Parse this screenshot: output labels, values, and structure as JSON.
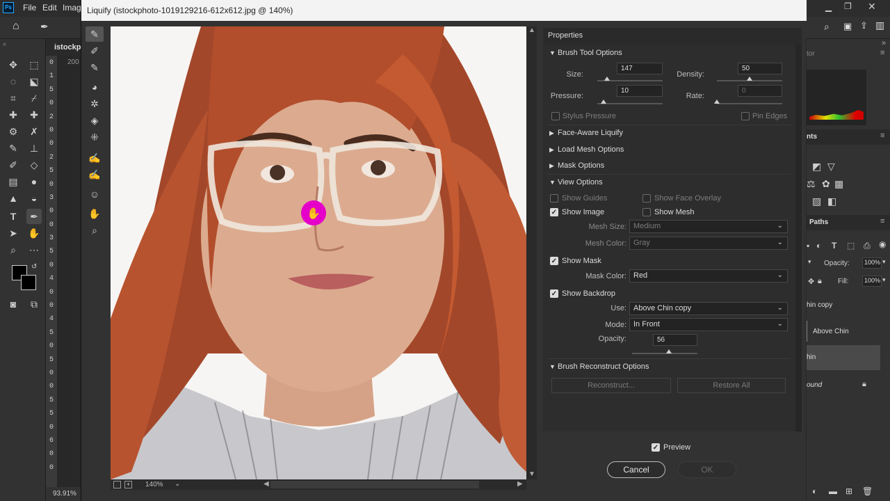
{
  "ps": {
    "logo": "Ps",
    "menus": [
      "File",
      "Edit",
      "Imag"
    ],
    "doc_tab": "istockpl",
    "ruler_top": "200",
    "ruler_digits": [
      "0",
      "1",
      "5",
      "0",
      "2",
      "0",
      "0",
      "2",
      "5",
      "0",
      "3",
      "0",
      "0",
      "3",
      "5",
      "0",
      "4",
      "0",
      "0",
      "4",
      "5",
      "0",
      "5",
      "0",
      "0",
      "5",
      "5",
      "0",
      "6",
      "0",
      "0"
    ],
    "zoom_status": "93.91%",
    "right_panels": {
      "tab1": "tor",
      "tab2": "nts",
      "paths": "Paths",
      "opacity_label": "Opacity:",
      "opacity_value": "100%",
      "fill_label": "Fill:",
      "fill_value": "100%",
      "layer1": "hin copy",
      "layer2": "Above Chin",
      "layer3": "hin",
      "layer4": "ound"
    }
  },
  "dialog": {
    "title": "Liquify (istockphoto-1019129216-612x612.jpg @ 140%)",
    "zoom": "140%",
    "properties": {
      "header": "Properties",
      "brush_tool_options": {
        "title": "Brush Tool Options",
        "size_label": "Size:",
        "size_value": "147",
        "size_level": 0.15,
        "density_label": "Density:",
        "density_value": "50",
        "density_level": 0.5,
        "pressure_label": "Pressure:",
        "pressure_value": "10",
        "pressure_level": 0.1,
        "rate_label": "Rate:",
        "rate_value": "0",
        "rate_level": 0,
        "stylus_pressure": "Stylus Pressure",
        "pin_edges": "Pin Edges"
      },
      "face_aware": "Face-Aware Liquify",
      "load_mesh": "Load Mesh Options",
      "mask_options": "Mask Options",
      "view_options": {
        "title": "View Options",
        "show_guides": "Show Guides",
        "show_face_overlay": "Show Face Overlay",
        "show_image": "Show Image",
        "show_mesh": "Show Mesh",
        "mesh_size_label": "Mesh Size:",
        "mesh_size_value": "Medium",
        "mesh_color_label": "Mesh Color:",
        "mesh_color_value": "Gray",
        "show_mask": "Show Mask",
        "mask_color_label": "Mask Color:",
        "mask_color_value": "Red",
        "show_backdrop": "Show Backdrop",
        "use_label": "Use:",
        "use_value": "Above Chin copy",
        "mode_label": "Mode:",
        "mode_value": "In Front",
        "opacity_label": "Opacity:",
        "opacity_value": "56",
        "opacity_level": 0.56
      },
      "brush_reconstruct": {
        "title": "Brush Reconstruct Options",
        "reconstruct": "Reconstruct...",
        "restore_all": "Restore All"
      }
    },
    "preview_label": "Preview",
    "cancel_label": "Cancel",
    "ok_label": "OK"
  },
  "colors": {
    "accent_cursor": "#e400c8",
    "hair": "#a84a28",
    "skin": "#d8a88c"
  }
}
